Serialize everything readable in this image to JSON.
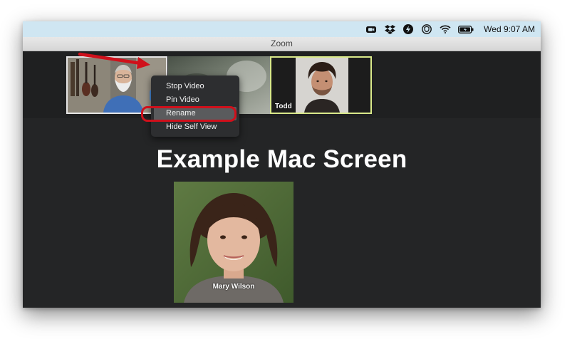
{
  "menubar": {
    "icons": [
      "zoom-video-icon",
      "dropbox-icon",
      "bolt-icon",
      "shield-icon",
      "wifi-icon",
      "battery-icon"
    ],
    "clock": "Wed 9:07 AM"
  },
  "window": {
    "title": "Zoom"
  },
  "participants": {
    "todd": {
      "name": "Todd"
    },
    "mary": {
      "name": "Mary Wilson"
    }
  },
  "more_button": {
    "label": "···"
  },
  "context_menu": {
    "items": [
      {
        "label": "Stop Video"
      },
      {
        "label": "Pin Video"
      },
      {
        "label": "Rename"
      },
      {
        "label": "Hide Self View"
      }
    ]
  },
  "overlay": {
    "heading": "Example Mac Screen"
  },
  "colors": {
    "callout": "#d0101b",
    "accent_button": "#4a90e2",
    "active_speaker_border": "#d9e98a",
    "menubar": "#cfe6f2"
  }
}
